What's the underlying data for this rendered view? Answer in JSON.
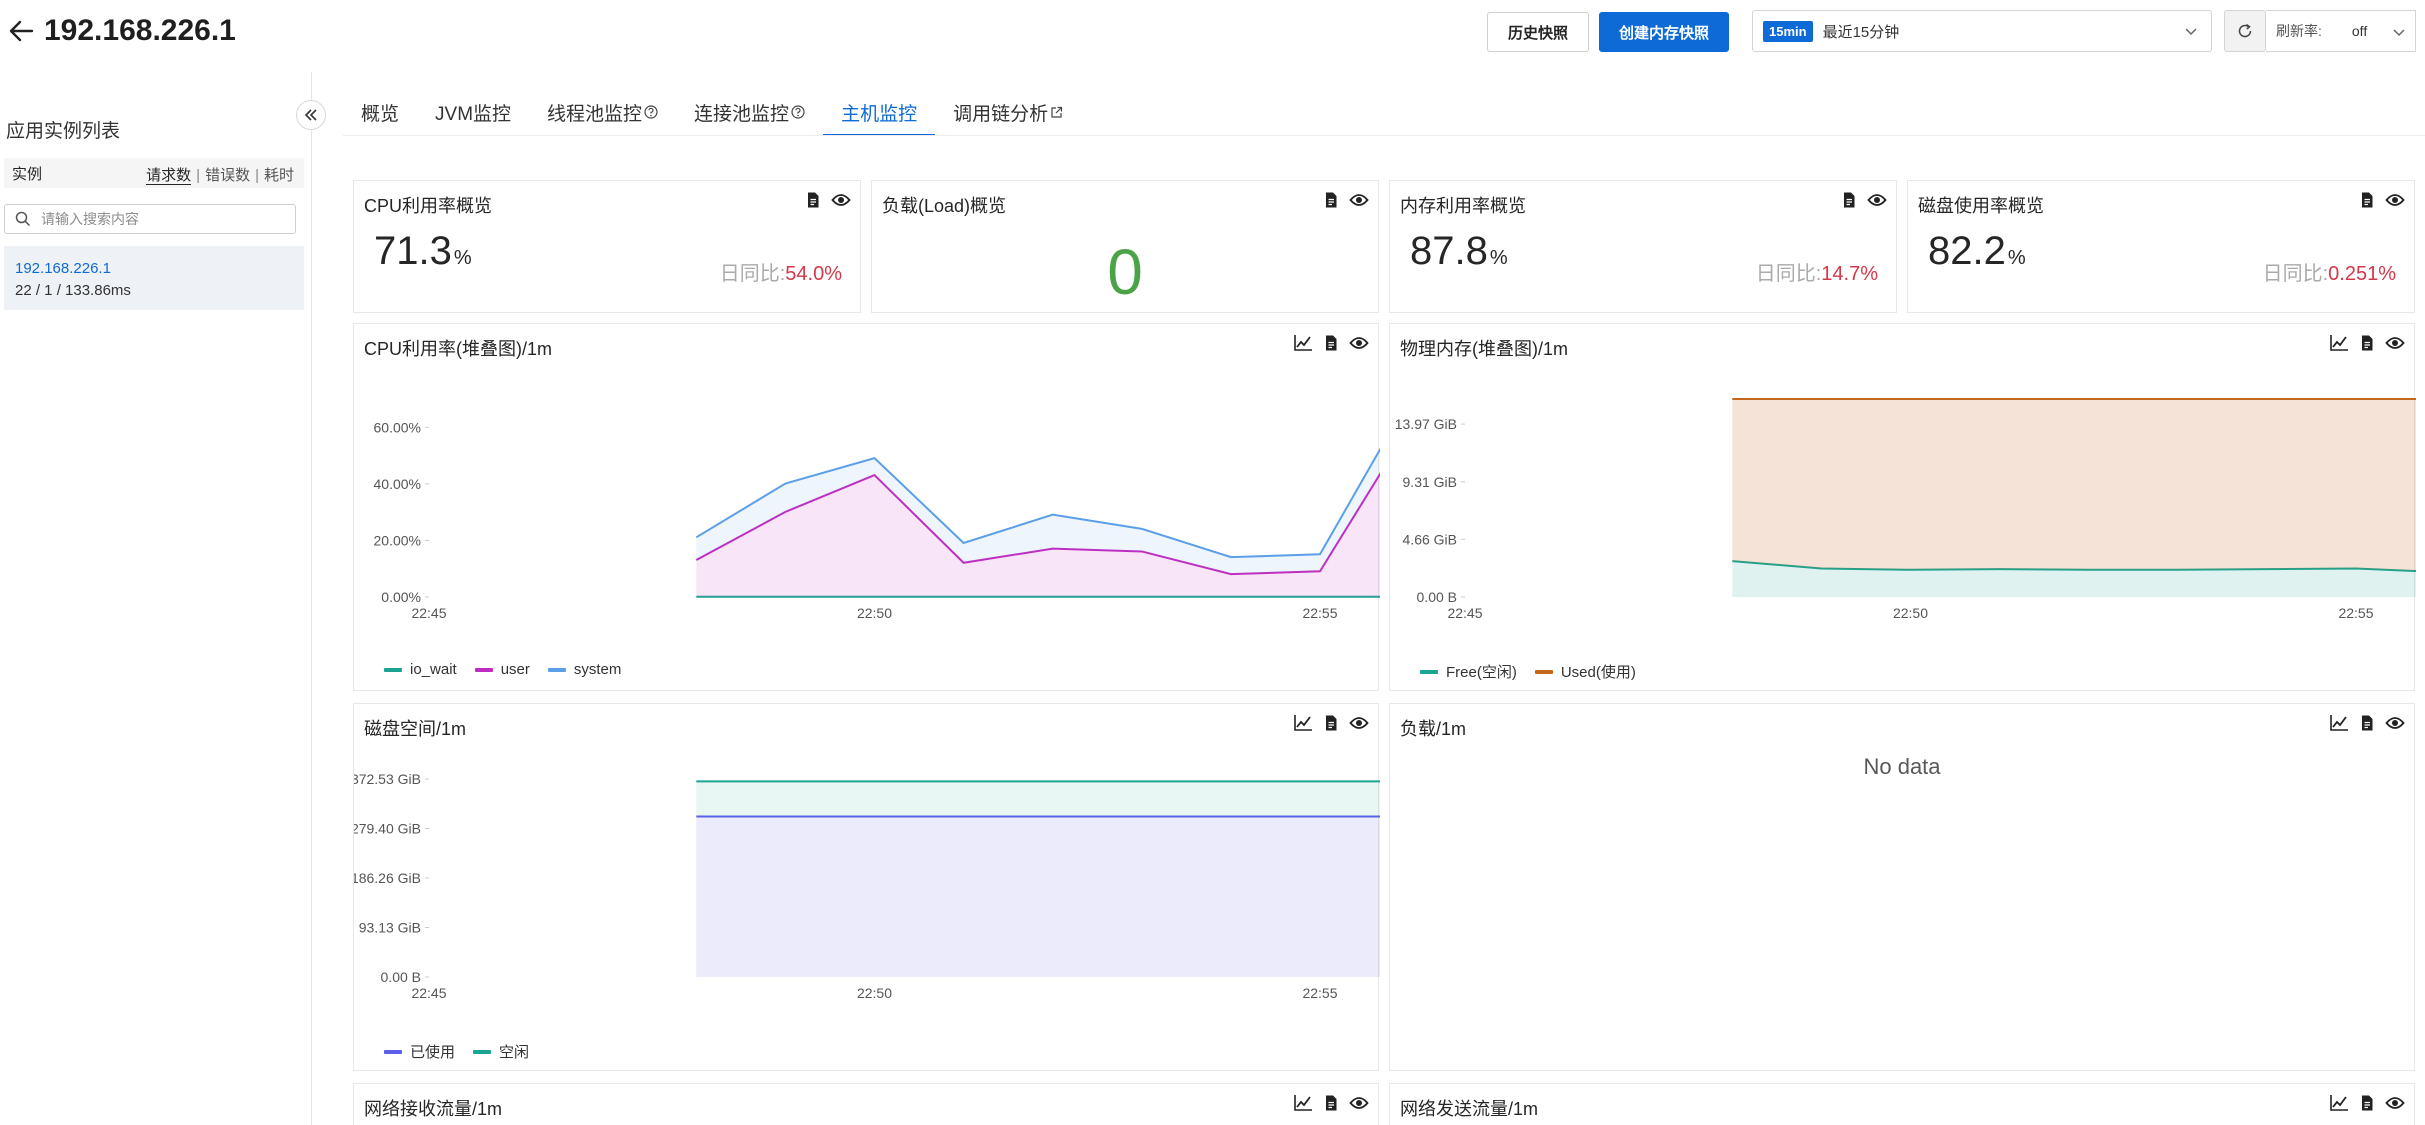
{
  "header": {
    "title": "192.168.226.1",
    "history_button": "历史快照",
    "snapshot_button": "创建内存快照",
    "time_badge": "15min",
    "time_label": "最近15分钟",
    "refresh_label": "刷新率:",
    "refresh_value": "off"
  },
  "sidebar": {
    "title": "应用实例列表",
    "instance_header": "实例",
    "sort_requests": "请求数",
    "sort_errors": "错误数",
    "sort_latency": "耗时",
    "search_placeholder": "请输入搜索内容",
    "instances": [
      {
        "ip": "192.168.226.1",
        "stats": "22 / 1 / 133.86ms"
      }
    ]
  },
  "tabs": [
    {
      "label": "概览",
      "active": false
    },
    {
      "label": "JVM监控",
      "active": false
    },
    {
      "label": "线程池监控",
      "active": false
    },
    {
      "label": "连接池监控",
      "active": false
    },
    {
      "label": "主机监控",
      "active": true
    },
    {
      "label": "调用链分析",
      "active": false
    }
  ],
  "overview": {
    "cpu": {
      "title": "CPU利用率概览",
      "value": "71.3",
      "unit": "%",
      "ratio_label": "日同比:",
      "ratio_value": "54.0%"
    },
    "load": {
      "title": "负载(Load)概览",
      "value": "0"
    },
    "memory": {
      "title": "内存利用率概览",
      "value": "87.8",
      "unit": "%",
      "ratio_label": "日同比:",
      "ratio_value": "14.7%"
    },
    "disk": {
      "title": "磁盘使用率概览",
      "value": "82.2",
      "unit": "%",
      "ratio_label": "日同比:",
      "ratio_value": "0.251%"
    }
  },
  "panels": {
    "cpu_chart_title": "CPU利用率(堆叠图)/1m",
    "mem_chart_title": "物理内存(堆叠图)/1m",
    "disk_chart_title": "磁盘空间/1m",
    "load_chart_title": "负载/1m",
    "load_no_data": "No data",
    "net_recv_title": "网络接收流量/1m",
    "net_send_title": "网络发送流量/1m"
  },
  "colors": {
    "accent": "#0e6ad6",
    "io_wait": "#1aa592",
    "user": "#c22bc0",
    "system": "#5b9fe8",
    "free": "#1aa592",
    "used": "#c4661b",
    "disk_used": "#5b5ee8",
    "disk_free": "#1aa592",
    "ratio_red": "#d4384a",
    "load_green": "#4aa447"
  },
  "chart_data": [
    {
      "type": "area",
      "title": "CPU利用率(堆叠图)/1m",
      "x": [
        "22:48",
        "22:49",
        "22:50",
        "22:51",
        "22:52",
        "22:53",
        "22:54",
        "22:55",
        "22:56"
      ],
      "x_ticks": [
        "22:45",
        "22:50",
        "22:55"
      ],
      "y_ticks": [
        "0.00%",
        "20.00%",
        "40.00%",
        "60.00%"
      ],
      "ylim": [
        0,
        70
      ],
      "stacked": true,
      "series": [
        {
          "name": "io_wait",
          "values": [
            0.1,
            0.1,
            0.1,
            0.1,
            0.1,
            0.1,
            0.1,
            0.1,
            0.1
          ]
        },
        {
          "name": "user",
          "values": [
            13,
            30,
            43,
            12,
            17,
            16,
            8,
            9,
            60
          ]
        },
        {
          "name": "system",
          "values": [
            8,
            10,
            6,
            7,
            12,
            8,
            6,
            6,
            10
          ]
        }
      ]
    },
    {
      "type": "area",
      "title": "物理内存(堆叠图)/1m",
      "x": [
        "22:48",
        "22:49",
        "22:50",
        "22:51",
        "22:52",
        "22:53",
        "22:54",
        "22:55",
        "22:56"
      ],
      "x_ticks": [
        "22:45",
        "22:50",
        "22:55"
      ],
      "y_ticks": [
        "0.00 B",
        "4.66 GiB",
        "9.31 GiB",
        "13.97 GiB"
      ],
      "ylim": [
        0,
        16.0
      ],
      "stacked": true,
      "series": [
        {
          "name": "Free(空闲)",
          "values": [
            2.9,
            2.3,
            2.2,
            2.25,
            2.2,
            2.2,
            2.25,
            2.3,
            2.0
          ]
        },
        {
          "name": "Used(使用)",
          "values": [
            13.1,
            13.7,
            13.8,
            13.75,
            13.8,
            13.8,
            13.75,
            13.7,
            14.0
          ]
        }
      ]
    },
    {
      "type": "area",
      "title": "磁盘空间/1m",
      "x": [
        "22:48",
        "22:49",
        "22:50",
        "22:51",
        "22:52",
        "22:53",
        "22:54",
        "22:55",
        "22:56"
      ],
      "x_ticks": [
        "22:45",
        "22:50",
        "22:55"
      ],
      "y_ticks": [
        "0.00 B",
        "93.13 GiB",
        "186.26 GiB",
        "279.40 GiB",
        "372.53 GiB"
      ],
      "ylim": [
        0,
        372.53
      ],
      "stacked": true,
      "series": [
        {
          "name": "已使用",
          "values": [
            302,
            302,
            302,
            302,
            302,
            302,
            302,
            302,
            302
          ]
        },
        {
          "name": "空闲",
          "values": [
            66,
            66,
            66,
            66,
            66,
            66,
            66,
            66,
            66
          ]
        }
      ]
    }
  ]
}
